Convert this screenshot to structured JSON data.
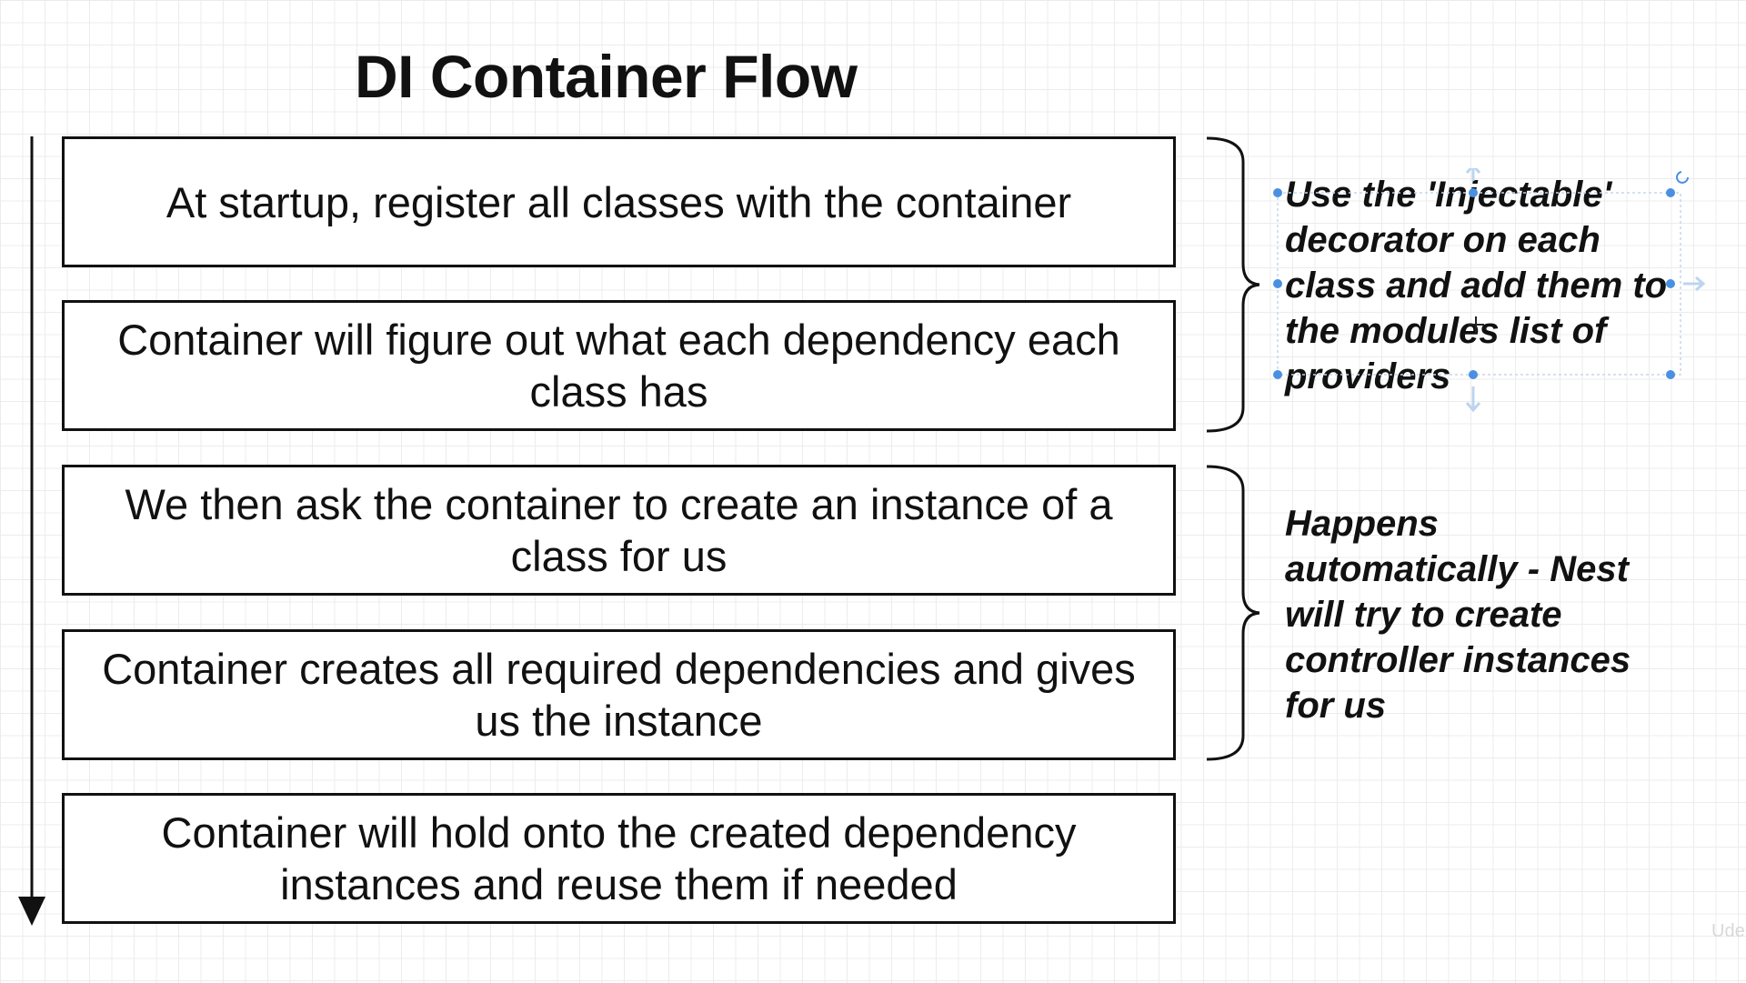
{
  "diagram": {
    "title": "DI Container Flow",
    "steps": [
      "At startup, register all classes with the container",
      "Container will figure out what each dependency each class has",
      "We then ask the container to create an instance of a class for us",
      "Container creates all required dependencies and gives us the instance",
      "Container will hold onto the created dependency instances and reuse them if needed"
    ],
    "notes": [
      "Use the 'Injectable' decorator on each class and add them to the modules list of providers",
      "Happens automatically - Nest will try to create controller instances for us"
    ]
  },
  "watermark": "Ude",
  "colors": {
    "ink": "#111111",
    "selection_handle": "#4a90e2",
    "grid": "#ececec",
    "background": "#ffffff"
  }
}
